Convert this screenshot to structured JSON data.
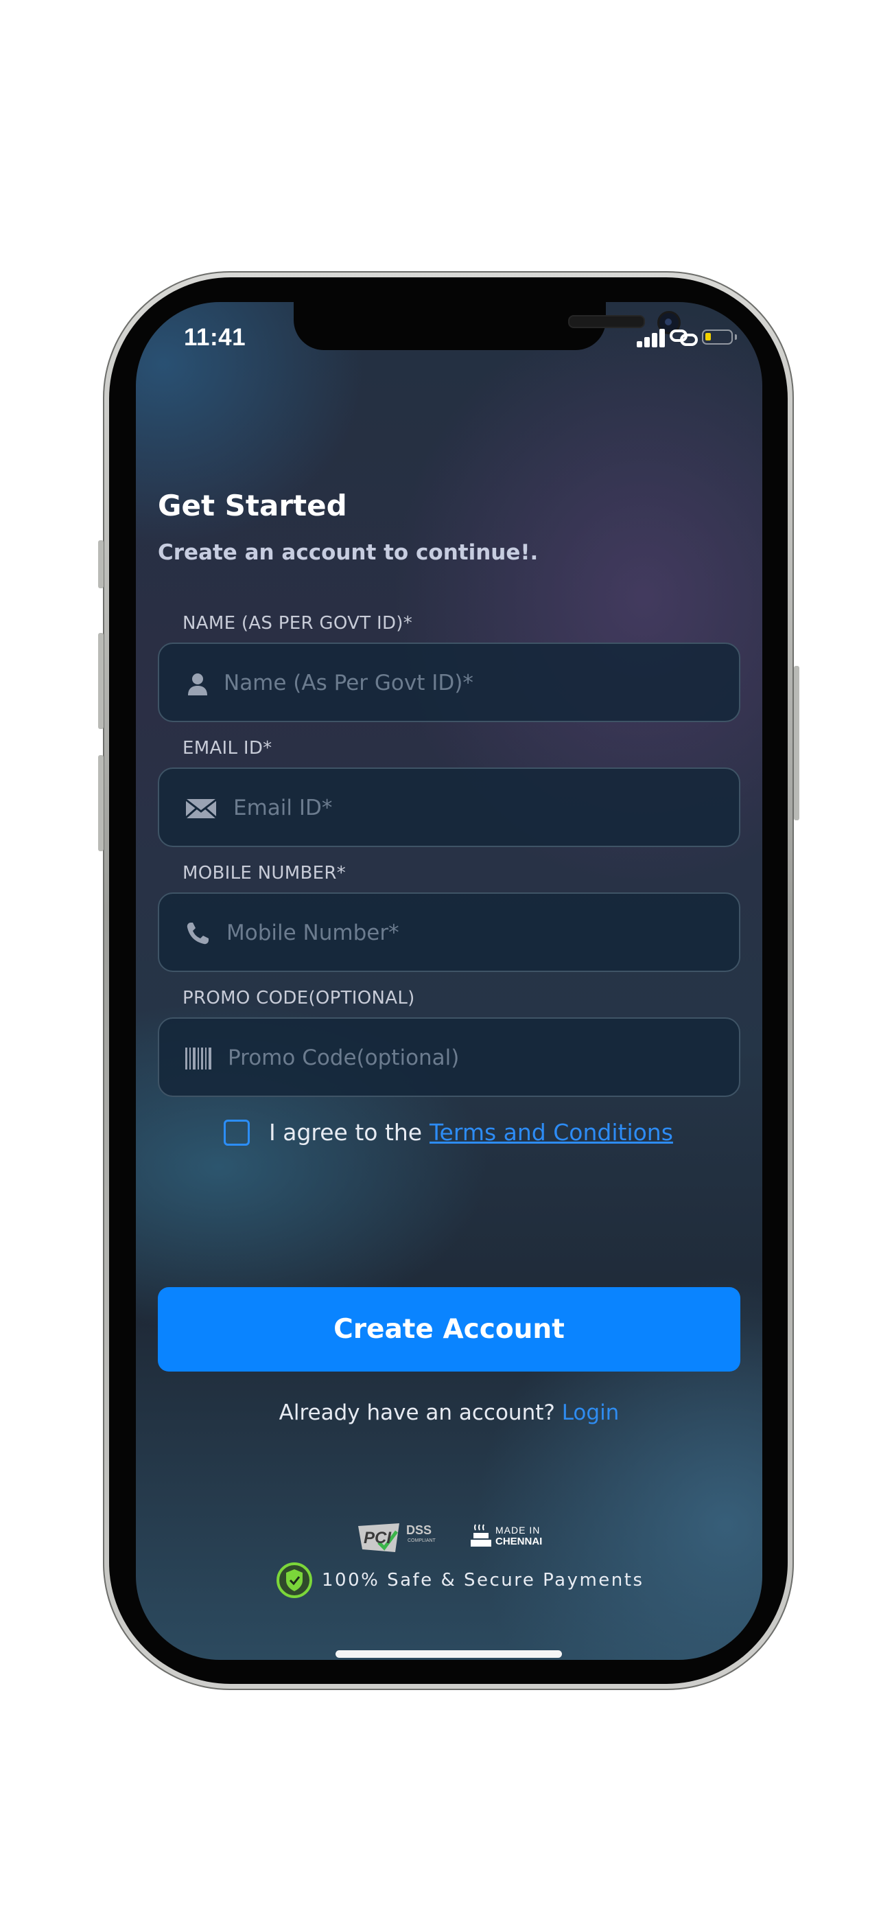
{
  "status_bar": {
    "time": "11:41"
  },
  "header": {
    "title": "Get Started",
    "subtitle": "Create an account to continue!."
  },
  "form": {
    "name": {
      "label": "NAME (AS PER GOVT ID)*",
      "placeholder": "Name (As Per Govt ID)*",
      "value": "",
      "icon": "person-icon"
    },
    "email": {
      "label": "EMAIL ID*",
      "placeholder": "Email ID*",
      "value": "",
      "icon": "envelope-icon"
    },
    "mobile": {
      "label": "MOBILE NUMBER*",
      "placeholder": "Mobile Number*",
      "value": "",
      "icon": "phone-icon"
    },
    "promo": {
      "label": "PROMO CODE(OPTIONAL)",
      "placeholder": "Promo Code(optional)",
      "value": "",
      "icon": "barcode-icon"
    }
  },
  "agreement": {
    "text": "I agree to the",
    "link_label": "Terms and Conditions",
    "checked": false
  },
  "cta": {
    "label": "Create Account"
  },
  "login": {
    "text": "Already have an account?",
    "link_label": "Login"
  },
  "footer": {
    "pci_text": "PCI",
    "dss_text": "DSS",
    "compliant_text": "COMPLIANT",
    "made_in_text": "MADE IN",
    "city_text": "CHENNAI",
    "secure_text": "100% Safe & Secure Payments"
  },
  "colors": {
    "accent": "#0a84ff",
    "link": "#2d8cf5",
    "battery": "#f2d200",
    "shield": "#7bd63a"
  }
}
